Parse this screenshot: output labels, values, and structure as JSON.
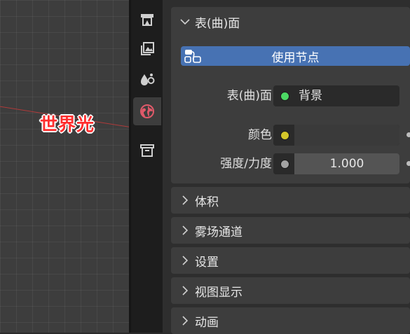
{
  "viewport": {
    "overlay_label": "世界光"
  },
  "tabs": [
    {
      "name": "render-tab",
      "icon": "render-icon"
    },
    {
      "name": "output-tab",
      "icon": "output-image-icon"
    },
    {
      "name": "view-layer-tab",
      "icon": "view-layer-icon"
    },
    {
      "name": "world-tab",
      "icon": "world-icon",
      "active": true
    },
    {
      "name": "collection-tab",
      "icon": "collection-box-icon"
    }
  ],
  "surface_section": {
    "header": "表(曲)面",
    "expanded": true,
    "use_nodes_label": "使用节点",
    "rows": {
      "surface": {
        "label": "表(曲)面",
        "value": "背景",
        "socket_color": "#4cd964"
      },
      "color": {
        "label": "颜色",
        "socket_color": "#d4c62a"
      },
      "strength": {
        "label": "强度/力度",
        "value": "1.000",
        "socket_color": "#a3a3a3"
      }
    }
  },
  "collapsed_sections": [
    {
      "label": "体积"
    },
    {
      "label": "雾场通道"
    },
    {
      "label": "设置"
    },
    {
      "label": "视图显示"
    },
    {
      "label": "动画"
    }
  ],
  "colors": {
    "accent": "#4772b3",
    "world_label": "#ff2e2e"
  }
}
